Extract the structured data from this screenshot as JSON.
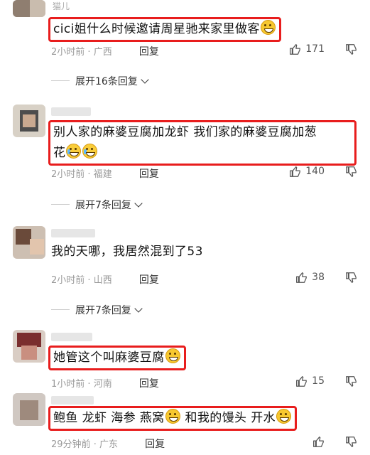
{
  "comments": [
    {
      "username": "猫儿",
      "text": "cici姐什么时候邀请周星驰来家里做客",
      "emoji": [
        "grin-icon"
      ],
      "time": "2小时前",
      "location": "广西",
      "reply_label": "回复",
      "likes": "171",
      "expand_label": "展开16条回复"
    },
    {
      "username": "",
      "text_line1": "别人家的麻婆豆腐加龙虾  我们家的麻婆豆腐加葱",
      "text_line2": "花",
      "emoji": [
        "tears-of-joy-icon",
        "tears-of-joy-icon"
      ],
      "time": "2小时前",
      "location": "福建",
      "reply_label": "回复",
      "likes": "140",
      "expand_label": "展开7条回复"
    },
    {
      "username": "",
      "text": "我的天哪，我居然混到了53",
      "time": "2小时前",
      "location": "山西",
      "reply_label": "回复",
      "likes": "38",
      "expand_label": "展开7条回复"
    },
    {
      "username": "",
      "text": "她管这个叫麻婆豆腐",
      "emoji": [
        "pleading-icon"
      ],
      "time": "1小时前",
      "location": "河南",
      "reply_label": "回复",
      "likes": "15"
    },
    {
      "username": "",
      "text_a": "鲍鱼 龙虾 海参 燕窝",
      "text_b": "和我的馒头 开水",
      "emoji": [
        "pleading-icon",
        "pleading-icon"
      ],
      "time": "29分钟前",
      "location": "广东",
      "reply_label": "回复"
    }
  ],
  "colors": {
    "highlight_border": "#e81d1d",
    "meta_gray": "#999999"
  }
}
